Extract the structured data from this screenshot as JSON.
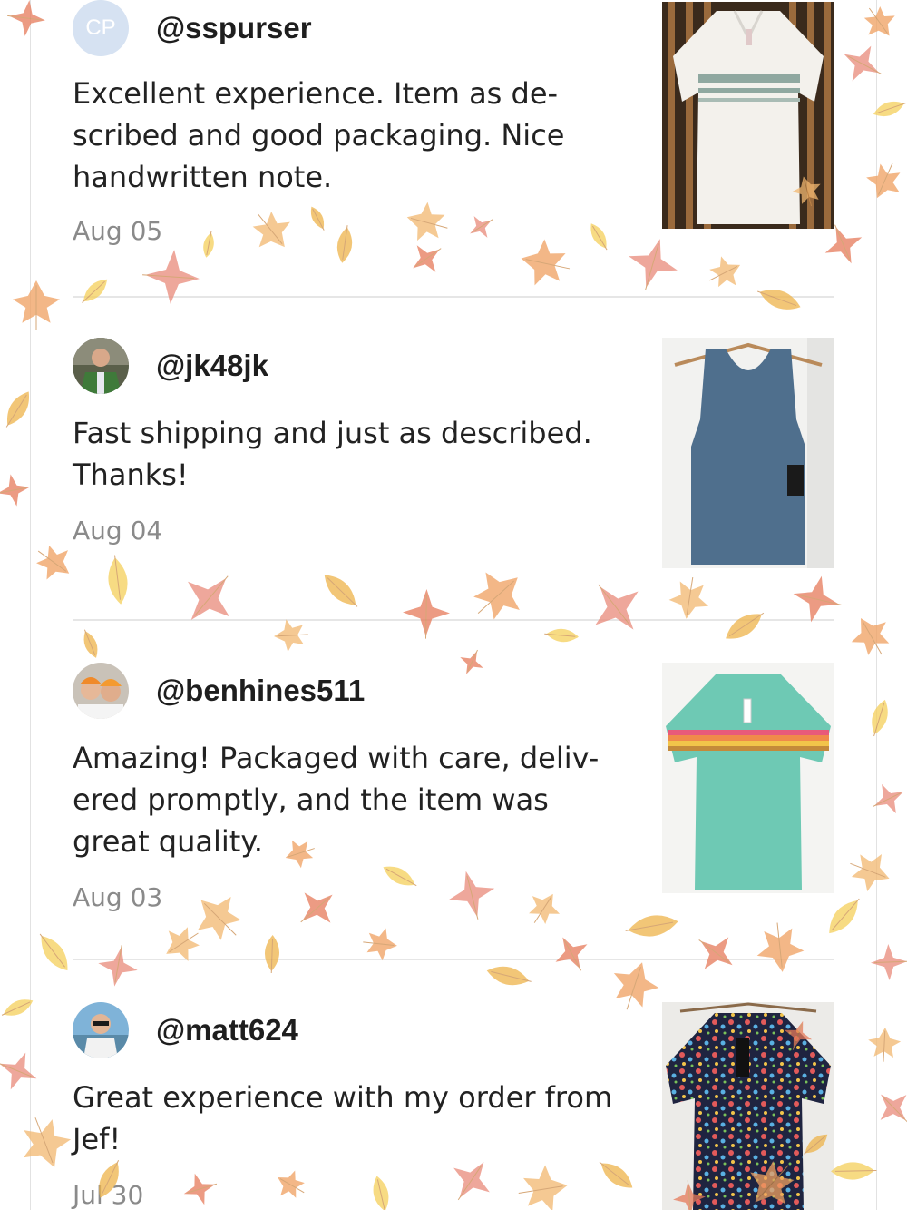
{
  "reviews": [
    {
      "avatar_initials": "CP",
      "username": "@sspurser",
      "body": "Excellent experience. Item as de-\nscribed and good packaging. Nice\nhandwritten note.",
      "date": "Aug 05",
      "avatar_icon": "initials-avatar",
      "photo_icon": "white-striped-polo-photo"
    },
    {
      "username": "@jk48jk",
      "body": "Fast shipping and just as described.\nThanks!",
      "date": "Aug 04",
      "avatar_icon": "man-green-vest-avatar",
      "photo_icon": "blue-tank-top-photo"
    },
    {
      "username": "@benhines511",
      "body": "Amazing! Packaged with care, deliv-\nered promptly, and the item was\ngreat quality.",
      "date": "Aug 03",
      "avatar_icon": "men-orange-caps-avatar",
      "photo_icon": "teal-striped-tee-photo"
    },
    {
      "username": "@matt624",
      "body": "Great experience with my order from\nJef!",
      "date": "Jul 30",
      "avatar_icon": "man-sunglasses-avatar",
      "photo_icon": "floral-print-shirt-photo"
    }
  ],
  "colors": {
    "date_gray": "#8a8a8a",
    "divider": "#e6e6e6",
    "leaf_orange": "#f0a060",
    "leaf_yellow": "#f5cf5a",
    "leaf_red": "#e98a7a"
  }
}
